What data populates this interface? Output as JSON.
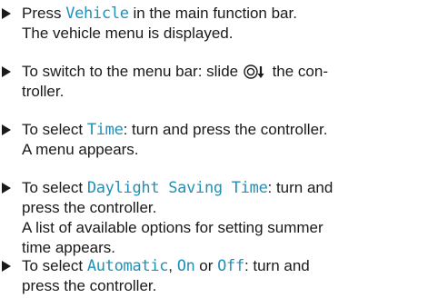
{
  "steps": [
    {
      "line1_before": "Press ",
      "line1_kw": "Vehicle",
      "line1_after": " in the main function bar.",
      "line2": "The vehicle menu is displayed."
    },
    {
      "line1_before": "To switch to the menu bar: slide ",
      "line1_after": " the con-",
      "line2": "troller.",
      "icon": "controller-slide-down-icon"
    },
    {
      "line1_before": "To select ",
      "line1_kw": "Time",
      "line1_after": ": turn and press the controller.",
      "line2": "A menu appears."
    },
    {
      "line1_before": "To select ",
      "line1_kw": "Daylight Saving Time",
      "line1_after": ": turn and",
      "line2": "press the controller.",
      "line3": "A list of available options for setting summer",
      "line4": "time appears."
    },
    {
      "line1_before": "To select ",
      "line1_kw1": "Automatic",
      "line1_sep1": ", ",
      "line1_kw2": "On",
      "line1_sep2": " or ",
      "line1_kw3": "Off",
      "line1_after": ": turn and",
      "line2": "press the controller."
    }
  ],
  "colors": {
    "keyword": "#1f90b8",
    "text": "#1a1a1a"
  }
}
